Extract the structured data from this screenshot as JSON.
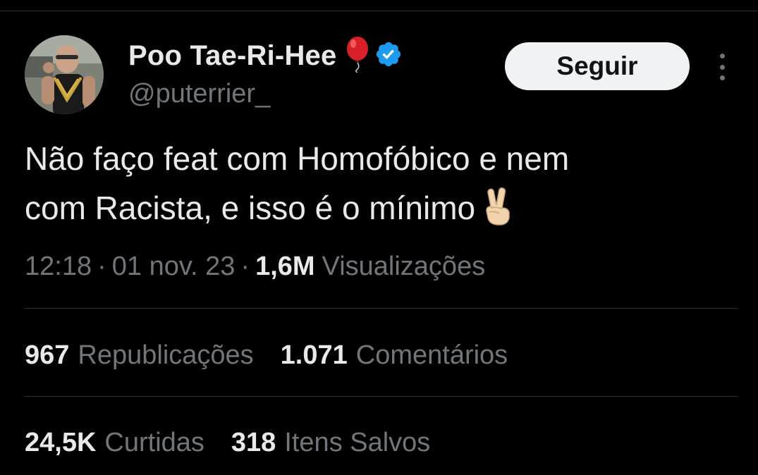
{
  "author": {
    "display_name": "Poo Tae-Ri-Hee",
    "handle": "@puterrier_",
    "name_emoji": "balloon-icon",
    "verified_color": "#1d9bf0"
  },
  "actions": {
    "follow_label": "Seguir",
    "more_icon": "more-vertical-icon"
  },
  "tweet": {
    "line1": "Não faço feat com Homofóbico e nem",
    "line2": "com Racista, e isso é o mínimo",
    "trailing_emoji": "victory-hand-icon"
  },
  "meta": {
    "time": "12:18",
    "separator": "·",
    "date": "01 nov. 23",
    "views_count": "1,6M",
    "views_label": "Visualizações"
  },
  "stats": {
    "reposts_count": "967",
    "reposts_label": "Republicações",
    "comments_count": "1.071",
    "comments_label": "Comentários",
    "likes_count": "24,5K",
    "likes_label": "Curtidas",
    "saves_count": "318",
    "saves_label": "Itens Salvos"
  },
  "colors": {
    "background": "#000000",
    "primary_text": "#e7e9ea",
    "secondary_text": "#71767b",
    "divider": "#2f3336",
    "button_bg": "#eff3f4",
    "button_text": "#0f1419",
    "verified": "#1d9bf0"
  }
}
